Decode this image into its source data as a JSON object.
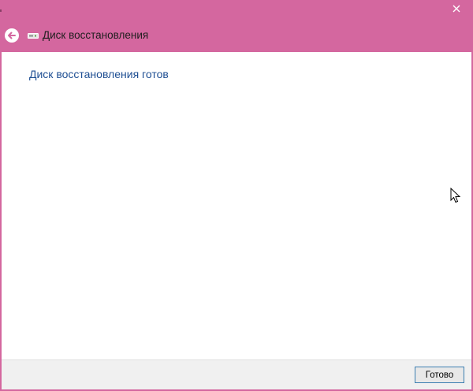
{
  "window": {
    "title": "Диск восстановления",
    "accent_color": "#d4679f"
  },
  "nav": {
    "back_icon": "back-arrow-icon",
    "drive_icon": "usb-drive-icon",
    "title": "Диск восстановления"
  },
  "content": {
    "heading": "Диск восстановления готов"
  },
  "footer": {
    "done_label": "Готово"
  },
  "titlebar": {
    "close_icon": "close-icon"
  }
}
